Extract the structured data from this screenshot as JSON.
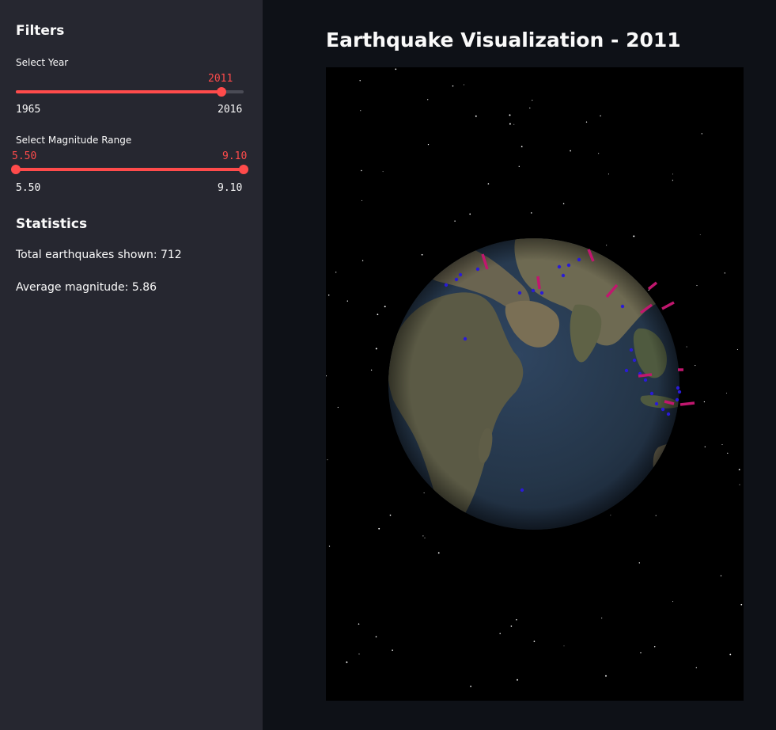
{
  "sidebar": {
    "filters_title": "Filters",
    "year": {
      "label": "Select Year",
      "min": "1965",
      "max": "2016",
      "value": "2011",
      "value_num": 2011,
      "min_num": 1965,
      "max_num": 2016
    },
    "magnitude": {
      "label": "Select Magnitude Range",
      "min": "5.50",
      "max": "9.10",
      "low": "5.50",
      "high": "9.10"
    },
    "statistics_title": "Statistics",
    "total_text": "Total earthquakes shown: 712",
    "average_text": "Average magnitude: 5.86"
  },
  "main": {
    "title": "Earthquake Visualization - 2011"
  },
  "colors": {
    "accent": "#ff4b4b",
    "sidebar_bg": "#262730",
    "main_bg": "#0e1117",
    "marker_blue": "#2a1bd6",
    "marker_magenta": "#c0176e"
  }
}
